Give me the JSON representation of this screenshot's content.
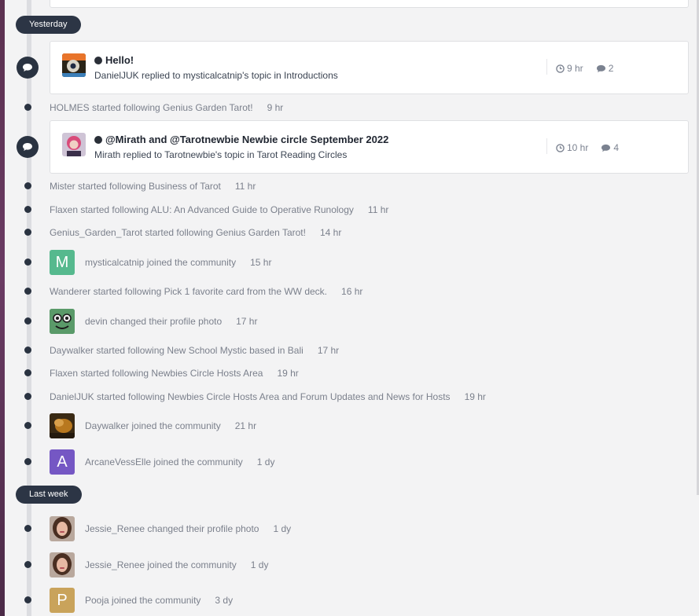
{
  "groups": {
    "yesterday": "Yesterday",
    "last_week": "Last week"
  },
  "cards": [
    {
      "title": "Hello!",
      "subtitle": "DanielJUK replied to mysticalcatnip's topic in Introductions",
      "time": "9 hr",
      "replies": "2"
    },
    {
      "title": "@Mirath and @Tarotnewbie Newbie circle September 2022",
      "subtitle": "Mirath replied to Tarotnewbie's topic in Tarot Reading Circles",
      "time": "10 hr",
      "replies": "4"
    }
  ],
  "activities": [
    {
      "text": "HOLMES started following Genius Garden Tarot!",
      "time": "9 hr"
    },
    {
      "text": "Mister started following Business of Tarot",
      "time": "11 hr"
    },
    {
      "text": "Flaxen started following ALU: An Advanced Guide to Operative Runology",
      "time": "11 hr"
    },
    {
      "text": "Genius_Garden_Tarot started following Genius Garden Tarot!",
      "time": "14 hr"
    },
    {
      "text": "mysticalcatnip joined the community",
      "time": "15 hr",
      "avatar_letter": "M",
      "avatar_color": "#56b98e"
    },
    {
      "text": "Wanderer started following Pick 1 favorite card from the WW deck.",
      "time": "16 hr"
    },
    {
      "text": "devin changed their profile photo",
      "time": "17 hr"
    },
    {
      "text": "Daywalker started following New School Mystic based in Bali",
      "time": "17 hr"
    },
    {
      "text": "Flaxen started following Newbies Circle Hosts Area",
      "time": "19 hr"
    },
    {
      "text": "DanielJUK started following Newbies Circle Hosts Area and Forum Updates and News for Hosts",
      "time": "19 hr"
    },
    {
      "text": "Daywalker joined the community",
      "time": "21 hr"
    },
    {
      "text": "ArcaneVessElle joined the community",
      "time": "1 dy",
      "avatar_letter": "A",
      "avatar_color": "#7557c4"
    },
    {
      "text": "Jessie_Renee changed their profile photo",
      "time": "1 dy"
    },
    {
      "text": "Jessie_Renee joined the community",
      "time": "1 dy"
    },
    {
      "text": "Pooja joined the community",
      "time": "3 dy",
      "avatar_letter": "P",
      "avatar_color": "#c9a35b"
    }
  ],
  "icons": {
    "comment": "comment-icon",
    "clock": "clock-icon",
    "bullet": "status-dot-icon"
  }
}
